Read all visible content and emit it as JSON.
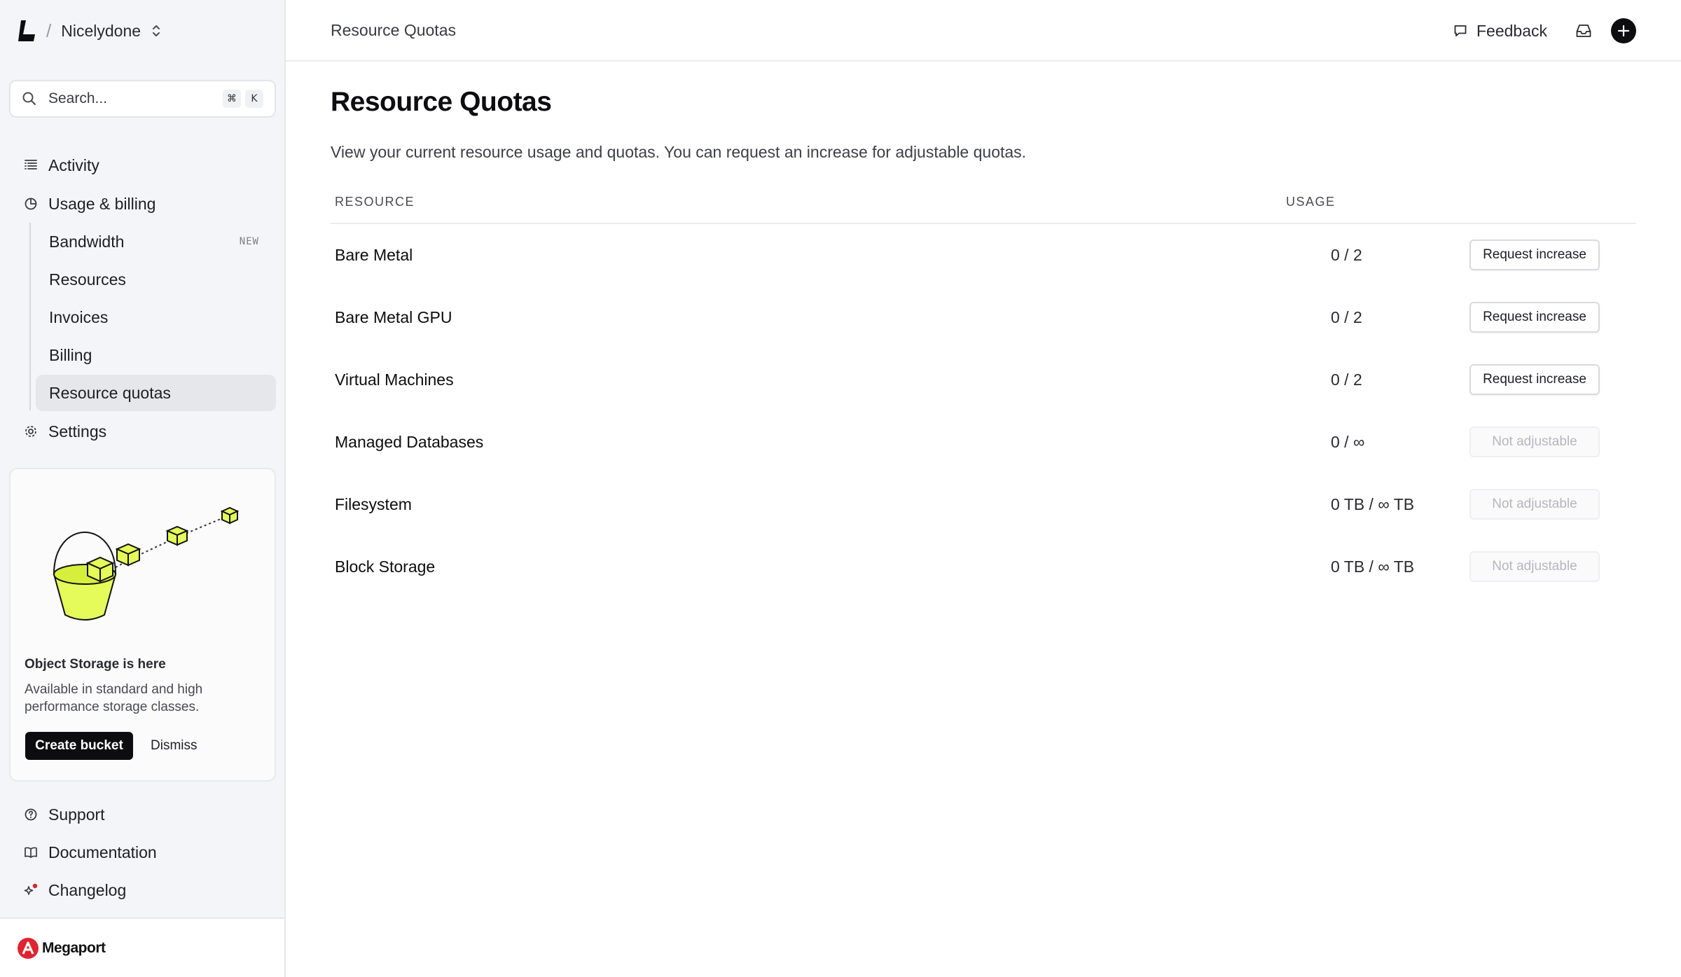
{
  "sidebar": {
    "workspace": "Nicelydone",
    "search": {
      "placeholder": "Search...",
      "shortcut_mod": "⌘",
      "shortcut_key": "K"
    },
    "nav": {
      "activity": "Activity",
      "usage_billing": "Usage & billing",
      "bandwidth": "Bandwidth",
      "bandwidth_badge": "NEW",
      "resources": "Resources",
      "invoices": "Invoices",
      "billing": "Billing",
      "resource_quotas": "Resource quotas",
      "settings": "Settings",
      "support": "Support",
      "documentation": "Documentation",
      "changelog": "Changelog"
    },
    "promo": {
      "title": "Object Storage is here",
      "description": "Available in standard and high performance storage classes.",
      "primary_label": "Create bucket",
      "secondary_label": "Dismiss",
      "accent_color": "#e4fb5a"
    },
    "brand": "Megaport",
    "active_item": "Resource quotas"
  },
  "topbar": {
    "breadcrumb": "Resource Quotas",
    "feedback_label": "Feedback"
  },
  "main": {
    "title": "Resource Quotas",
    "description": "View your current resource usage and quotas. You can request an increase for adjustable quotas.",
    "columns": {
      "resource": "RESOURCE",
      "usage": "USAGE"
    },
    "rows": [
      {
        "name": "Bare Metal",
        "usage": "0 / 2",
        "action": "Request increase",
        "adjustable": true
      },
      {
        "name": "Bare Metal GPU",
        "usage": "0 / 2",
        "action": "Request increase",
        "adjustable": true
      },
      {
        "name": "Virtual Machines",
        "usage": "0 / 2",
        "action": "Request increase",
        "adjustable": true
      },
      {
        "name": "Managed Databases",
        "usage": "0 / ∞",
        "action": "Not adjustable",
        "adjustable": false
      },
      {
        "name": "Filesystem",
        "usage": "0 TB / ∞ TB",
        "action": "Not adjustable",
        "adjustable": false
      },
      {
        "name": "Block Storage",
        "usage": "0 TB / ∞ TB",
        "action": "Not adjustable",
        "adjustable": false
      }
    ]
  }
}
